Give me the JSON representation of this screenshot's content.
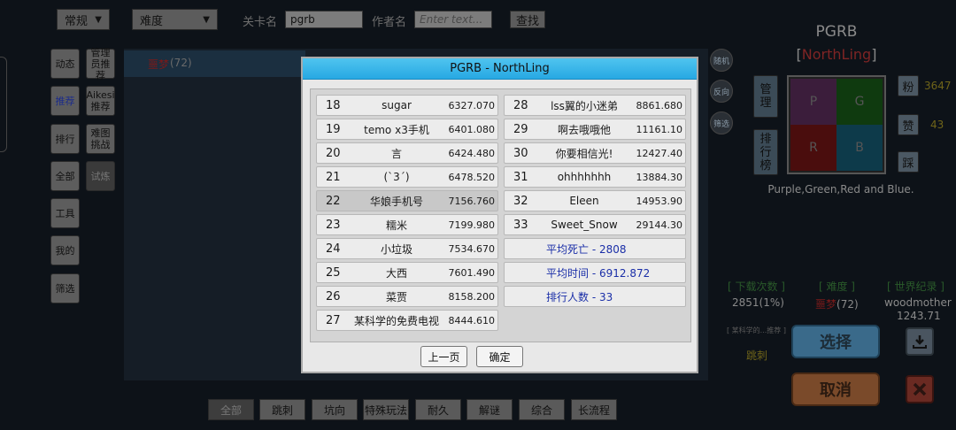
{
  "top": {
    "filter_select": "常规",
    "difficulty_select": "难度",
    "level_name_label": "关卡名",
    "level_name_value": "pgrb",
    "author_label": "作者名",
    "author_placeholder": "Enter text...",
    "search_button": "查找"
  },
  "sidebar": {
    "left": [
      "动态",
      "推荐",
      "排行",
      "全部",
      "工具",
      "我的",
      "筛选"
    ],
    "right": [
      "管理员推荐",
      "Aikesi推荐",
      "难图挑战",
      "试炼"
    ]
  },
  "list": {
    "first_item_name": "噩梦",
    "first_item_value": "(72)"
  },
  "round_buttons": [
    "随机",
    "反向",
    "筛选"
  ],
  "categories": [
    "全部",
    "跳刺",
    "坑向",
    "特殊玩法",
    "耐久",
    "解谜",
    "综合",
    "长流程"
  ],
  "detail": {
    "title": "PGRB",
    "author_open": "[",
    "author": "NorthLing",
    "author_close": "]",
    "manage_button": "管理",
    "rank_button": "排行榜",
    "fans_label": "粉",
    "fans_count": "3647",
    "likes_label": "赞",
    "likes_count": "43",
    "dislike_label": "踩",
    "preview_letters": [
      "P",
      "G",
      "R",
      "B"
    ],
    "description": "Purple,Green,Red and Blue.",
    "downloads_header": "[ 下载次数 ]",
    "downloads_value": "2851(1%)",
    "difficulty_header": "[ 难度 ]",
    "difficulty_value": "噩梦",
    "difficulty_value_num": "(72)",
    "record_header": "[ 世界纪录 ]",
    "record_holder": "woodmother",
    "record_time": "1243.71",
    "recommend_text": "[ 某科学的...推荐 ]",
    "tag": "跳刺",
    "select_button": "选择",
    "cancel_button": "取消"
  },
  "modal": {
    "title": "PGRB - NorthLing",
    "left_rows": [
      {
        "rank": "18",
        "name": "sugar",
        "time": "6327.070"
      },
      {
        "rank": "19",
        "name": "temo x3手机",
        "time": "6401.080"
      },
      {
        "rank": "20",
        "name": "言",
        "time": "6424.480"
      },
      {
        "rank": "21",
        "name": "(`3´)",
        "time": "6478.520"
      },
      {
        "rank": "22",
        "name": "华娘手机号",
        "time": "7156.760"
      },
      {
        "rank": "23",
        "name": "糯米",
        "time": "7199.980"
      },
      {
        "rank": "24",
        "name": "小垃圾",
        "time": "7534.670"
      },
      {
        "rank": "25",
        "name": "大西",
        "time": "7601.490"
      },
      {
        "rank": "26",
        "name": "菜贾",
        "time": "8158.200"
      },
      {
        "rank": "27",
        "name": "某科学的免费电视",
        "time": "8444.610"
      }
    ],
    "right_rows": [
      {
        "rank": "28",
        "name": "lss翼的小迷弟",
        "time": "8861.680"
      },
      {
        "rank": "29",
        "name": "啊去哦哦他",
        "time": "11161.10"
      },
      {
        "rank": "30",
        "name": "你要相信光!",
        "time": "12427.40"
      },
      {
        "rank": "31",
        "name": "ohhhhhhh",
        "time": "13884.30"
      },
      {
        "rank": "32",
        "name": "Eleen",
        "time": "14953.90"
      },
      {
        "rank": "33",
        "name": "Sweet_Snow",
        "time": "29144.30"
      }
    ],
    "stats": [
      "平均死亡 - 2808",
      "平均时间 - 6912.872",
      "排行人数 - 33"
    ],
    "prev_button": "上一页",
    "ok_button": "确定"
  }
}
